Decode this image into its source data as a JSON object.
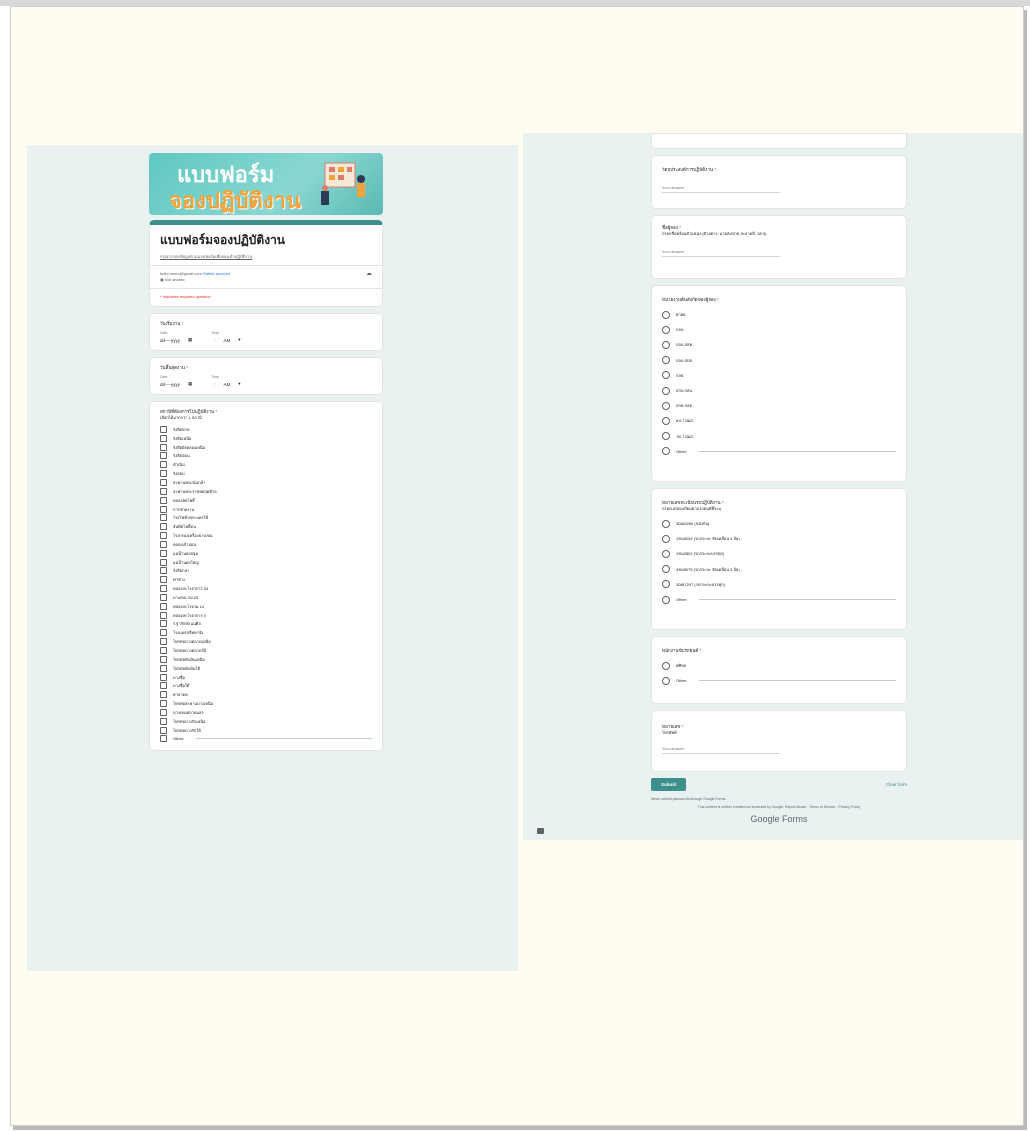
{
  "left_form": {
    "banner": {
      "line1": "แบบฟอร์ม",
      "line2": "จองปฏิบัติงาน"
    },
    "title": "แบบฟอร์มจองปฏิบัติงาน",
    "description": "กรุณากรอกข้อมูลตามแบบฟอร์มเพื่อจองเข้าปฏิบัติงาน",
    "account": {
      "email": "build.homo@gmail.com",
      "switch_label": "Switch account",
      "not_shared": "Not shared"
    },
    "required_note": "* Indicates required question",
    "start_date": {
      "title": "วันเริ่มงาน",
      "date_label": "Date",
      "time_label": "Time",
      "date_placeholder": "dd----yyyy",
      "time_sep": ":",
      "ampm": "AM"
    },
    "end_date": {
      "title": "วันสิ้นสุดงาน",
      "date_label": "Date",
      "time_label": "Time",
      "date_placeholder": "dd----yyyy",
      "time_sep": ":",
      "ampm": "AM"
    },
    "stations": {
      "title": "สถานีที่ต้องการไปปฏิบัติงาน",
      "subtitle": "เลือกได้มากกว่า 1 สถานี",
      "options": [
        "รังสิตทาด",
        "รังสิตเหนือ",
        "รังสิตฝั่งคลองเหนือ",
        "รังสิตอ่อน",
        "ดำเนิน",
        "รังสอบ",
        "สะพานพระนั่งเกล้า",
        "สะพานพระราชพ่อสุดท้าย",
        "คลองจัดโพธิ์",
        "การช่วยงาน",
        "โรงไฟฟ้าพระนครใต้",
        "จันทิตโพธิ์ดน",
        "โรงกรองเครื่องบางเขน",
        "คลองเจ้าอ่อน",
        "แม่น้ำนครปฐม",
        "แม่น้ำนครใหญ่",
        "รังสิตกล่า",
        "ท่าช่าง",
        "คลองสะโรงกการ 34",
        "บางเขน กม.25",
        "คลองสะโรงกม.14",
        "คลองสะโรงกการ 0",
        "ร.ฐารักษ์ถนนศิล",
        "โรงแพรกลีทคาจัง",
        "โทรท่อบางตลาดเหนือ",
        "โทรท่อบางตลาดใต้",
        "โทรท่อพังเงินเหนือ",
        "โทรท่อพังเงินใต้",
        "บางซื่อ",
        "บางซื่อใต้",
        "ศาลาดด",
        "โทรท่อสะพานบางเหนือ",
        "บางเขนตลาดแสง",
        "โทรท่อบางรักเหนือ",
        "โทรท่อบางรักใต้",
        "Other:"
      ]
    }
  },
  "right_form": {
    "purpose": {
      "title": "วัตถุประสงค์การปฏิบัติงาน",
      "placeholder": "Your answer"
    },
    "booker": {
      "title": "ชื่อผู้จอง",
      "subtitle": "กรอกชื่อพร้อมตำแหน่ง (ตัวอย่าง: นายสมชาย สะอาดดี, วศ.3)",
      "placeholder": "Your answer"
    },
    "unit": {
      "title": "หน่วยงานต้นสังกัดของผู้จอง",
      "options": [
        "ฝ่ายด.",
        "กอบ.",
        "กอบ.สสท.",
        "กอบ.สปธ.",
        "กสธ.",
        "สกบ.กสม.",
        "สกพ.กสธ.",
        "ผบ.7 ฝมส.",
        "วด.7 ฝมส.",
        "Other:"
      ]
    },
    "vehicle": {
      "title": "หมายเลขทะเบียนรถปฏิบัติงาน",
      "subtitle": "กรอกเลขทะเบียนตามรถยนต์ที่ระบุ",
      "options": [
        "3ฌน5260 (ของกัน)",
        "1ขน5254 (รถกระบะ ขับเคลื่อน 4 ล้อ)",
        "1ขน2801 (รถกระบะบรรทุก)",
        "4ขน5075 (รถกระบะ ขับเคลื่อน 4 ล้อ)",
        "3ฌข7207 (รถกระบะบรรทุก)",
        "Other:"
      ]
    },
    "driver": {
      "title": "พนักงานขับรถยนต์",
      "options": [
        "ศศิพล",
        "Other:"
      ]
    },
    "phone": {
      "title": "หมายเลข",
      "subtitle": "โทรศัพท์",
      "placeholder": "Your answer"
    },
    "submit_label": "Submit",
    "clear_label": "Clear form",
    "warning": "Never submit passwords through Google Forms.",
    "disclaimer": "This content is neither created nor endorsed by Google. Report Abuse - Terms of Service - Privacy Policy",
    "brand": "Google Forms"
  }
}
